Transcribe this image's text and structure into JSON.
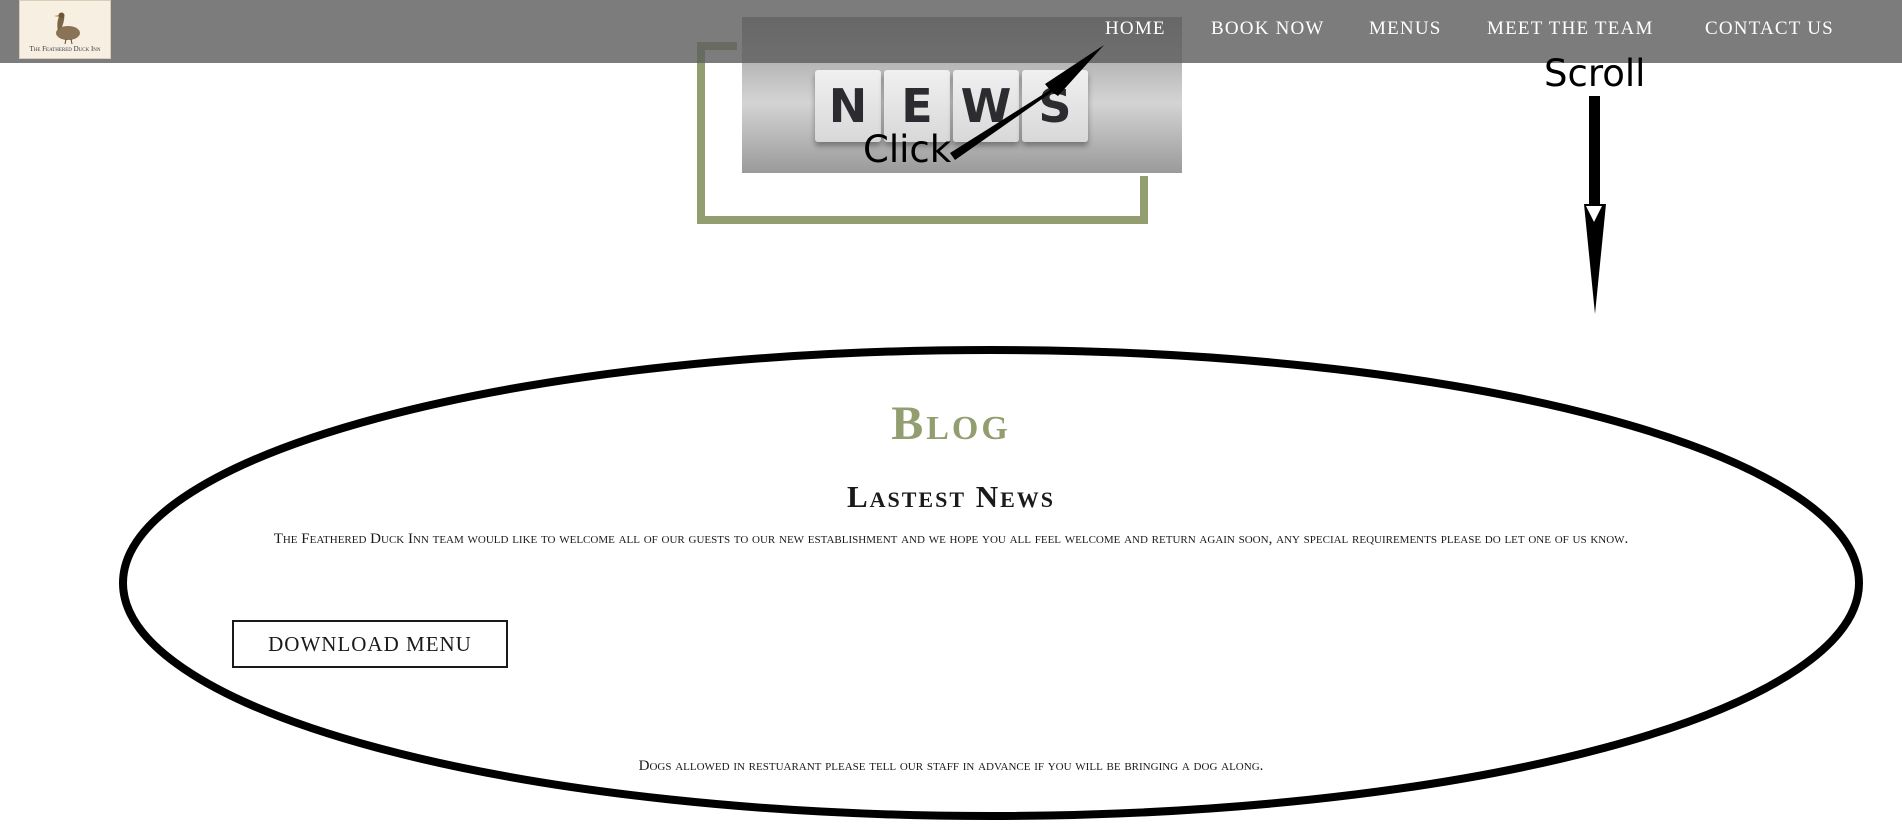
{
  "header": {
    "logo_text": "The Feathered Duck Inn",
    "nav": [
      {
        "label": "HOME"
      },
      {
        "label": "BOOK NOW"
      },
      {
        "label": "MENUS"
      },
      {
        "label": "MEET THE TEAM"
      },
      {
        "label": "CONTACT US"
      }
    ]
  },
  "hero": {
    "image_letters": [
      "N",
      "E",
      "W",
      "S"
    ]
  },
  "annotations": {
    "click_label": "Click",
    "scroll_label": "Scroll"
  },
  "blog": {
    "title": "Blog",
    "subtitle": "Lastest News",
    "body": "The Feathered Duck Inn team would like to welcome all of our guests to our new establishment and we hope you all feel welcome and return again soon, any special requirements please do let one of us know.",
    "button_label": "DOWNLOAD MENU",
    "dogs_note": "Dogs allowed in restuarant please tell our staff in advance if you will be bringing a dog along."
  },
  "colors": {
    "accent_green": "#929e6f",
    "nav_background": "#5f5f5f",
    "text": "#1a1a1a"
  }
}
